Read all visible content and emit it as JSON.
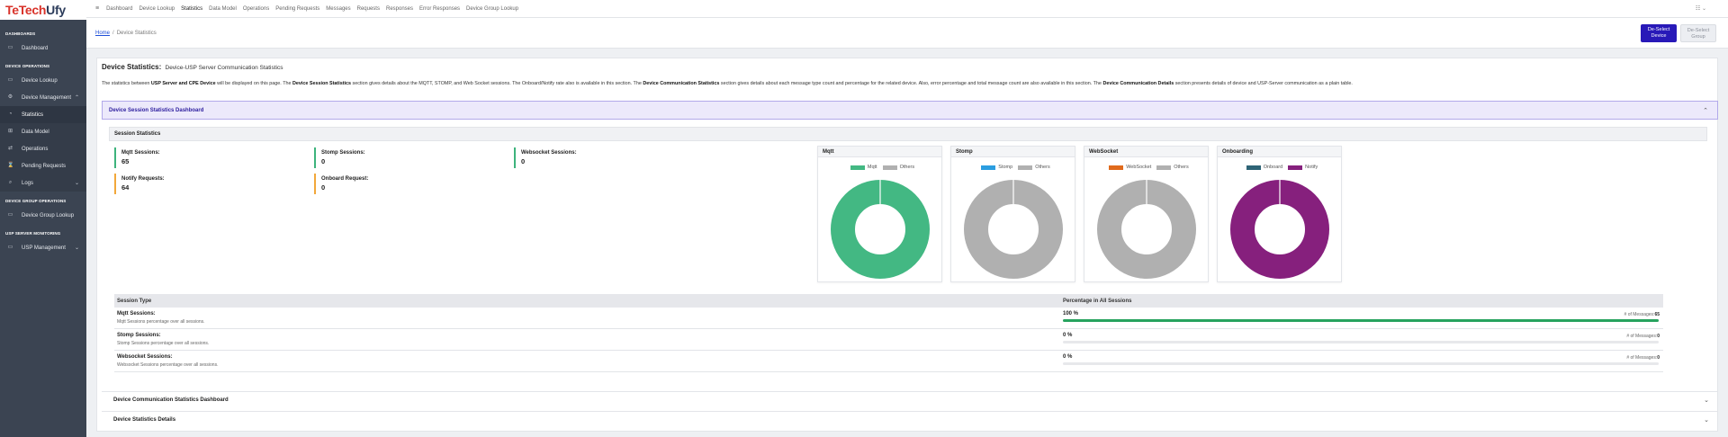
{
  "brand": {
    "name_part1": "TeTech",
    "name_part2": "Ufy"
  },
  "sidebar": {
    "sections": [
      {
        "title": "DASHBOARDS",
        "items": [
          {
            "label": "Dashboard",
            "icon": "dashboard-icon"
          }
        ]
      },
      {
        "title": "DEVICE OPERATIONS",
        "items": [
          {
            "label": "Device Lookup",
            "icon": "device-icon"
          },
          {
            "label": "Device Management",
            "icon": "gear-icon"
          },
          {
            "label": "Statistics",
            "icon": "chart-icon"
          },
          {
            "label": "Data Model",
            "icon": "model-icon"
          },
          {
            "label": "Operations",
            "icon": "operations-icon"
          },
          {
            "label": "Pending Requests",
            "icon": "pending-icon"
          },
          {
            "label": "Logs",
            "icon": "search-icon"
          }
        ]
      },
      {
        "title": "DEVICE GROUP OPERATIONS",
        "items": [
          {
            "label": "Device Group Lookup",
            "icon": "group-icon"
          }
        ]
      },
      {
        "title": "USP SERVER MONITORING",
        "items": [
          {
            "label": "USP Management",
            "icon": "server-icon"
          }
        ]
      }
    ]
  },
  "topnav": [
    "Dashboard",
    "Device Lookup",
    "Statistics",
    "Data Model",
    "Operations",
    "Pending Requests",
    "Messages",
    "Requests",
    "Responses",
    "Error Responses",
    "Device Group Lookup"
  ],
  "breadcrumb": {
    "home": "Home",
    "sep": "/",
    "current": "Device Statistics"
  },
  "buttons": {
    "deselect_device_l1": "De-Select",
    "deselect_device_l2": "Device",
    "deselect_group_l1": "De-Select",
    "deselect_group_l2": "Group"
  },
  "page": {
    "title": "Device Statistics:",
    "subtitle": "Device-USP Server Communication Statistics"
  },
  "description": {
    "t1": "The statistics between ",
    "b1": "USP Server and CPE Device",
    "t2": " will be displayed on this page. The ",
    "b2": "Device Session Statistics",
    "t3": " section gives details about the MQTT, STOMP, and Web Socket sessions. The Onboard/Notify rate also is available in this section. The ",
    "b3": "Device Communication Statistics",
    "t4": " section gives details about each message type count and percentage for the related device. Also, error percentage and total message count are also available in this section. The ",
    "b4": "Device Communication Details",
    "t5": " section presents details of device and USP-Server communication as a plain table."
  },
  "session_dashboard": {
    "title": "Device Session Statistics Dashboard",
    "section_title": "Session Statistics",
    "stats": {
      "mqtt_label": "Mqtt Sessions:",
      "mqtt_value": "65",
      "stomp_label": "Stomp Sessions:",
      "stomp_value": "0",
      "ws_label": "Websocket Sessions:",
      "ws_value": "0",
      "notify_label": "Notify Requests:",
      "notify_value": "64",
      "onboard_label": "Onboard Request:",
      "onboard_value": "0"
    },
    "pies": [
      {
        "title": "Mqtt",
        "legend": [
          "Mqtt",
          "Others"
        ],
        "colors": [
          "#43b883",
          "#b0b0b0"
        ],
        "values": [
          65,
          0
        ]
      },
      {
        "title": "Stomp",
        "legend": [
          "Stomp",
          "Others"
        ],
        "colors": [
          "#2b9de0",
          "#b0b0b0"
        ],
        "values": [
          0,
          1
        ]
      },
      {
        "title": "WebSocket",
        "legend": [
          "WebSocket",
          "Others"
        ],
        "colors": [
          "#e06a1c",
          "#b0b0b0"
        ],
        "values": [
          0,
          1
        ]
      },
      {
        "title": "Onboarding",
        "legend": [
          "Onboard",
          "Notify"
        ],
        "colors": [
          "#2e6476",
          "#86207d"
        ],
        "values": [
          0,
          64
        ]
      }
    ],
    "table": {
      "col1": "Session Type",
      "col2": "Percentage in All Sessions",
      "msg_label": "# of Messages:",
      "rows": [
        {
          "name": "Mqtt Sessions:",
          "desc": "Mqtt Sessions percentage over all sessions.",
          "pct": "100 %",
          "pct_value": 100,
          "count": "65"
        },
        {
          "name": "Stomp Sessions:",
          "desc": "Stomp Sessions percentage over all sessions.",
          "pct": "0 %",
          "pct_value": 0,
          "count": "0"
        },
        {
          "name": "Websocket Sessions:",
          "desc": "Websocket Sessions percentage over all sessions.",
          "pct": "0 %",
          "pct_value": 0,
          "count": "0"
        }
      ]
    }
  },
  "accordions": {
    "comm": "Device Communication Statistics Dashboard",
    "details": "Device Statistics Details"
  }
}
